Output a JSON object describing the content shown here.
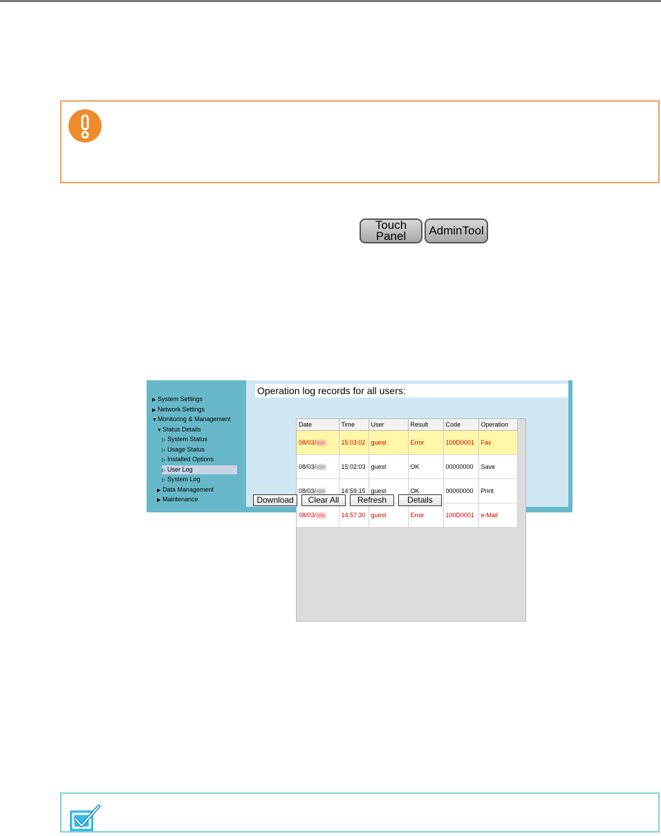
{
  "mode_badges": {
    "touch_panel_line1": "Touch",
    "touch_panel_line2": "Panel",
    "admin_tool": "AdminTool"
  },
  "screenshot": {
    "sidebar": {
      "items": [
        {
          "label": "System Settings",
          "marker": "▶"
        },
        {
          "label": "Network Settings",
          "marker": "▶"
        },
        {
          "label": "Monitoring & Management",
          "marker": "▼"
        },
        {
          "label": "Status Details",
          "marker": "▼"
        },
        {
          "label": "System Status",
          "marker": "▷"
        },
        {
          "label": "Usage Status",
          "marker": "▷"
        },
        {
          "label": "Installed Options",
          "marker": "▷"
        },
        {
          "label": "User Log",
          "marker": "▷",
          "selected": true
        },
        {
          "label": "System Log",
          "marker": "▷"
        },
        {
          "label": "Data Management",
          "marker": "▶"
        },
        {
          "label": "Maintenance",
          "marker": "▶"
        }
      ]
    },
    "header": "Operation log records for all users:",
    "table": {
      "columns": [
        "Date",
        "Time",
        "User",
        "Result",
        "Code",
        "Operation"
      ],
      "rows": [
        {
          "date": "08/03/",
          "time": "15:03:02",
          "user": "guest",
          "result": "Error",
          "code": "100D0001",
          "operation": "Fax",
          "status": "error",
          "selected": true
        },
        {
          "date": "08/03/",
          "time": "15:02:03",
          "user": "guest",
          "result": "OK",
          "code": "00000000",
          "operation": "Save",
          "status": "ok",
          "selected": false
        },
        {
          "date": "08/03/",
          "time": "14:59:15",
          "user": "guest",
          "result": "OK",
          "code": "00000000",
          "operation": "Print",
          "status": "ok",
          "selected": false
        },
        {
          "date": "08/03/",
          "time": "14:57:30",
          "user": "guest",
          "result": "Error",
          "code": "100D0001",
          "operation": "e-Mail",
          "status": "error",
          "selected": false
        }
      ]
    },
    "buttons": {
      "download": "Download",
      "clear_all": "Clear All",
      "refresh": "Refresh",
      "details": "Details"
    }
  },
  "colors": {
    "caution_accent": "#ee8b2b",
    "tip_accent": "#3bb8e6",
    "error_text": "#cc0000"
  },
  "icons": {
    "caution": "exclamation-circle-icon",
    "tip": "checkmark-icon"
  }
}
